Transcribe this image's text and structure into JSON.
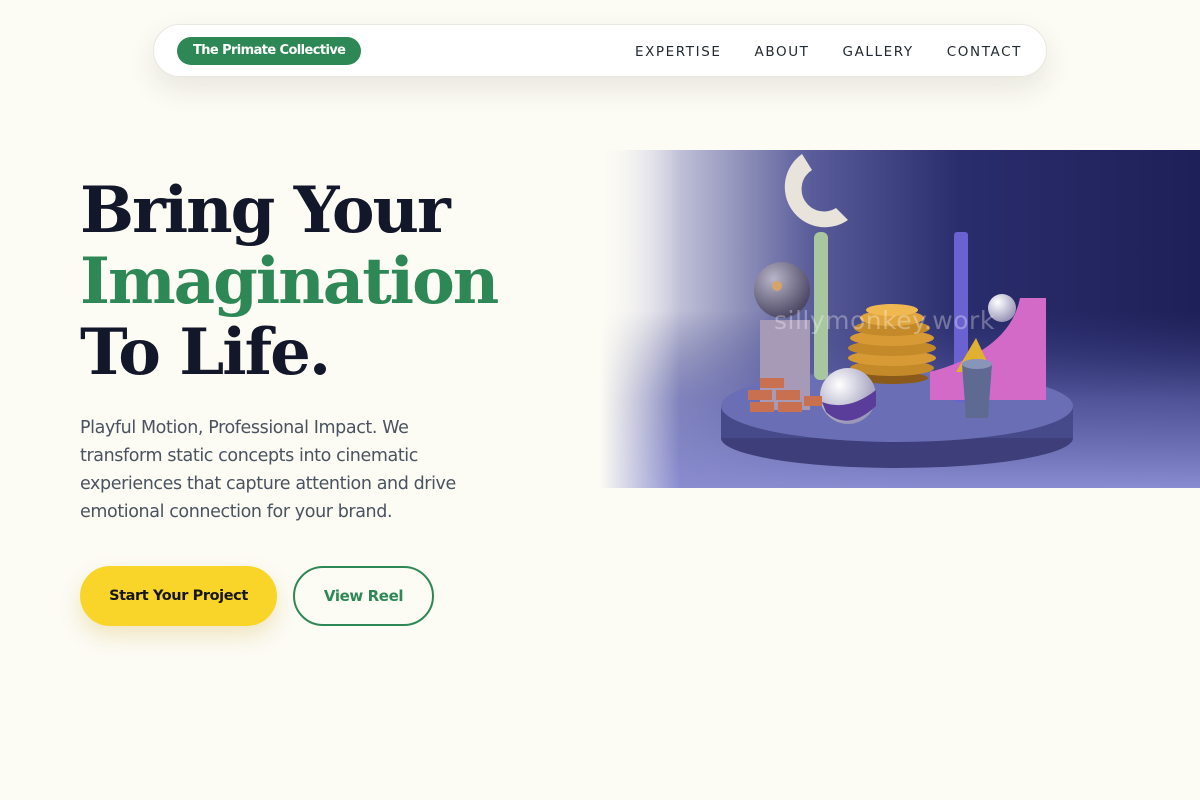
{
  "nav": {
    "brand": "The Primate Collective",
    "links": [
      "EXPERTISE",
      "ABOUT",
      "GALLERY",
      "CONTACT"
    ]
  },
  "hero": {
    "headline_line1": "Bring Your",
    "headline_line2": "Imagination",
    "headline_line3": "To Life.",
    "subtitle": "Playful Motion, Professional Impact. We transform static concepts into cinematic experiences that capture attention and drive emotional connection for your brand.",
    "primary_cta": "Start Your Project",
    "secondary_cta": "View Reel",
    "media_watermark": "sillymonkey.work"
  },
  "colors": {
    "background": "#fcfbf4",
    "brand_green": "#2e8856",
    "cta_yellow": "#f9d52a",
    "heading_dark": "#121729",
    "body_text": "#4a5360"
  }
}
